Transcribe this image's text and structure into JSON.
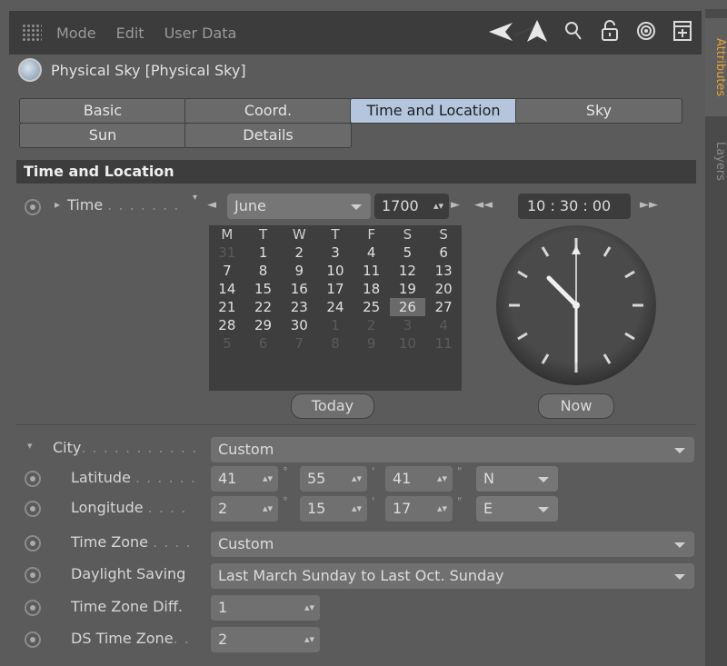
{
  "menubar": {
    "items": [
      "Mode",
      "Edit",
      "User Data"
    ],
    "tools": [
      "back-arrow-icon",
      "cursor-arrow-icon",
      "search-icon",
      "lock-icon",
      "target-icon",
      "new-panel-icon"
    ]
  },
  "side_tabs": [
    "Attributes",
    "Layers"
  ],
  "object": {
    "title": "Physical Sky [Physical Sky]"
  },
  "tabs": [
    {
      "label": "Basic"
    },
    {
      "label": "Coord."
    },
    {
      "label": "Time and Location",
      "active": true
    },
    {
      "label": "Sky"
    },
    {
      "label": "Sun"
    },
    {
      "label": "Details"
    }
  ],
  "section": {
    "title": "Time and Location"
  },
  "time": {
    "label": "Time",
    "dots": ". . . . . . .",
    "month": "June",
    "year": "1700",
    "clock_text": "10 : 30 : 00",
    "today_label": "Today",
    "now_label": "Now"
  },
  "calendar": {
    "headers": [
      "M",
      "T",
      "W",
      "T",
      "F",
      "S",
      "S"
    ],
    "rows": [
      [
        "31",
        "1",
        "2",
        "3",
        "4",
        "5",
        "6"
      ],
      [
        "7",
        "8",
        "9",
        "10",
        "11",
        "12",
        "13"
      ],
      [
        "14",
        "15",
        "16",
        "17",
        "18",
        "19",
        "20"
      ],
      [
        "21",
        "22",
        "23",
        "24",
        "25",
        "26",
        "27"
      ],
      [
        "28",
        "29",
        "30",
        "1",
        "2",
        "3",
        "4"
      ],
      [
        "5",
        "6",
        "7",
        "8",
        "9",
        "10",
        "11"
      ]
    ],
    "selected": "26"
  },
  "location": {
    "city_label": "City",
    "city_dots": ". . . . . . . . . . .",
    "city_value": "Custom",
    "latitude_label": "Latitude",
    "latitude_dots": ". . . . . .",
    "latitude": {
      "deg": "41",
      "min": "55",
      "sec": "41",
      "dir": "N"
    },
    "longitude_label": "Longitude",
    "longitude_dots": ". . . .",
    "longitude": {
      "deg": "2",
      "min": "15",
      "sec": "17",
      "dir": "E"
    },
    "timezone_label": "Time Zone",
    "timezone_dots": ". . . .",
    "timezone_value": "Custom",
    "daylight_label": "Daylight Saving",
    "daylight_value": "Last March Sunday to Last Oct. Sunday",
    "tzdiff_label": "Time Zone Diff.",
    "tzdiff_value": "1",
    "dstz_label": "DS Time Zone",
    "dstz_dots": ". .",
    "dstz_value": "2"
  }
}
